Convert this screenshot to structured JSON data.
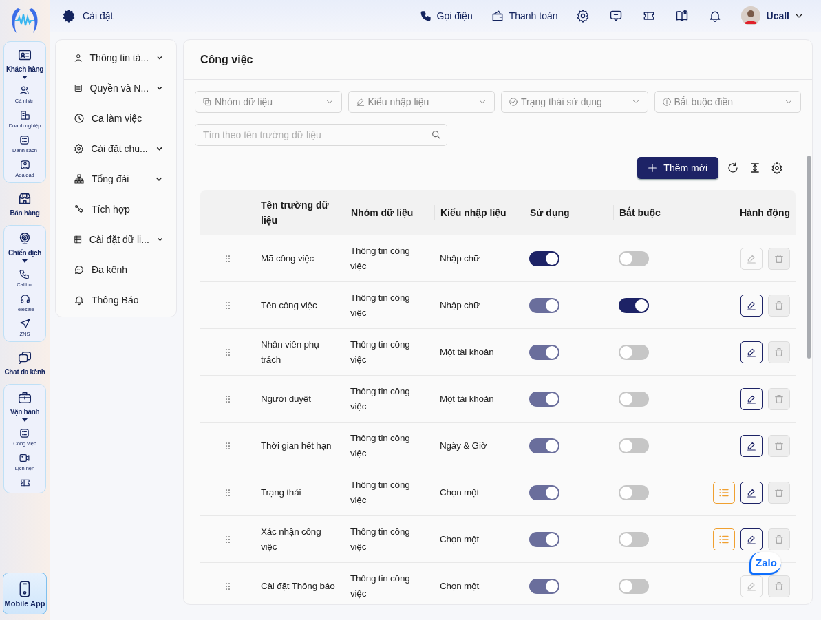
{
  "rail": {
    "groups": [
      {
        "label": "Khách hàng",
        "children": [
          {
            "label": "Cá nhân"
          },
          {
            "label": "Doanh nghiệp"
          },
          {
            "label": "Danh sách"
          },
          {
            "label": "Adalead"
          }
        ]
      },
      {
        "label": "Bán hàng"
      },
      {
        "label": "Chiến dịch",
        "children": [
          {
            "label": "Callbot"
          },
          {
            "label": "Telesale"
          },
          {
            "label": "ZNS"
          }
        ]
      },
      {
        "label": "Chat đa kênh"
      },
      {
        "label": "Vận hành",
        "children": [
          {
            "label": "Công việc"
          },
          {
            "label": "Lịch hẹn"
          }
        ]
      }
    ],
    "mobile_app": "Mobile App"
  },
  "topbar": {
    "title": "Cài đặt",
    "actions": [
      "Gọi điện",
      "Thanh toán"
    ],
    "user": "Ucall"
  },
  "settings_nav": [
    {
      "label": "Thông tin tà...",
      "expandable": true
    },
    {
      "label": "Quyền và N...",
      "expandable": true
    },
    {
      "label": "Ca làm việc",
      "expandable": false
    },
    {
      "label": "Cài đặt chu...",
      "expandable": true
    },
    {
      "label": "Tổng đài",
      "expandable": true
    },
    {
      "label": "Tích hợp",
      "expandable": false
    },
    {
      "label": "Cài đặt dữ li...",
      "expandable": true
    },
    {
      "label": "Đa kênh",
      "expandable": false
    },
    {
      "label": "Thông Báo",
      "expandable": false
    }
  ],
  "page": {
    "title": "Công việc",
    "filters": [
      "Nhóm dữ liệu",
      "Kiểu nhập liệu",
      "Trạng thái sử dụng",
      "Bắt buộc điền"
    ],
    "search": {
      "placeholder": "Tìm theo tên trường dữ liệu"
    },
    "add_button": "Thêm mới"
  },
  "table": {
    "columns": [
      "Tên trường dữ liệu",
      "Nhóm dữ liệu",
      "Kiểu nhập liệu",
      "Sử dụng",
      "Bắt buộc",
      "Hành động"
    ],
    "rows": [
      {
        "name": "Mã công việc",
        "group": "Thông tin công việc",
        "type": "Nhập chữ",
        "used": {
          "on": true,
          "disabled": false
        },
        "required": {
          "on": false
        },
        "options": false,
        "edit_disabled": true
      },
      {
        "name": "Tên công việc",
        "group": "Thông tin công việc",
        "type": "Nhập chữ",
        "used": {
          "on": true,
          "disabled": true
        },
        "required": {
          "on": true
        },
        "options": false,
        "edit_disabled": false
      },
      {
        "name": "Nhân viên phụ trách",
        "group": "Thông tin công việc",
        "type": "Một tài khoản",
        "used": {
          "on": true,
          "disabled": true
        },
        "required": {
          "on": false
        },
        "options": false,
        "edit_disabled": false
      },
      {
        "name": "Người duyệt",
        "group": "Thông tin công việc",
        "type": "Một tài khoản",
        "used": {
          "on": true,
          "disabled": true
        },
        "required": {
          "on": false
        },
        "options": false,
        "edit_disabled": false
      },
      {
        "name": "Thời gian hết hạn",
        "group": "Thông tin công việc",
        "type": "Ngày & Giờ",
        "used": {
          "on": true,
          "disabled": true
        },
        "required": {
          "on": false
        },
        "options": false,
        "edit_disabled": false
      },
      {
        "name": "Trạng thái",
        "group": "Thông tin công việc",
        "type": "Chọn một",
        "used": {
          "on": true,
          "disabled": true
        },
        "required": {
          "on": false
        },
        "options": true,
        "edit_disabled": false
      },
      {
        "name": "Xác nhận công việc",
        "group": "Thông tin công việc",
        "type": "Chọn một",
        "used": {
          "on": true,
          "disabled": true
        },
        "required": {
          "on": false
        },
        "options": true,
        "edit_disabled": false
      },
      {
        "name": "Cài đặt Thông báo",
        "group": "Thông tin công việc",
        "type": "Chọn một",
        "used": {
          "on": true,
          "disabled": true
        },
        "required": {
          "on": false
        },
        "options": false,
        "edit_disabled": true
      }
    ]
  },
  "zalo": "Zalo"
}
